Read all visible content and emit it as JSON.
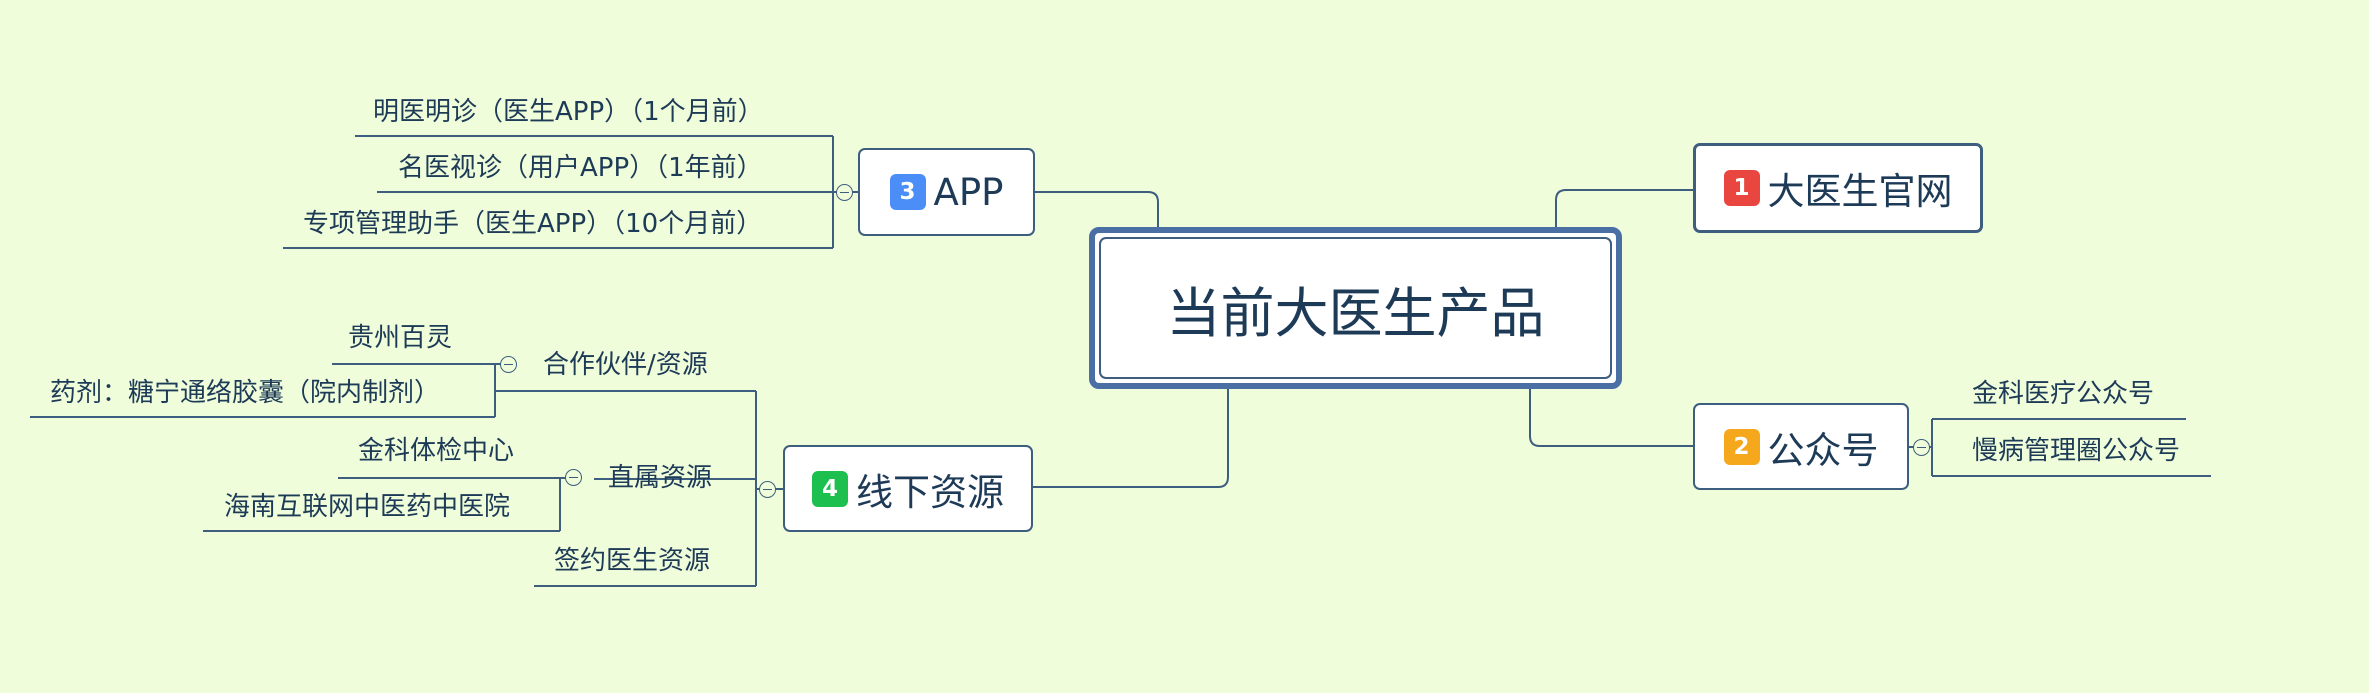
{
  "center": {
    "label": "当前大医生产品"
  },
  "colors": {
    "background": "#f0fddb",
    "line": "#3d5e7f",
    "center_border": "#4a6fa5",
    "badge_1": "#e8463e",
    "badge_2": "#f5a81c",
    "badge_3": "#4c8ef7",
    "badge_4": "#1dbf4f"
  },
  "topics": {
    "official_site": {
      "badge": "1",
      "label": "大医生官网"
    },
    "wechat": {
      "badge": "2",
      "label": "公众号",
      "children": [
        "金科医疗公众号",
        "慢病管理圈公众号"
      ]
    },
    "app": {
      "badge": "3",
      "label": "APP",
      "children": [
        "明医明诊（医生APP）（1个月前）",
        "名医视诊（用户APP）（1年前）",
        "专项管理助手（医生APP）（10个月前）"
      ]
    },
    "offline": {
      "badge": "4",
      "label": "线下资源",
      "partners": {
        "label": "合作伙伴/资源",
        "children": [
          "贵州百灵",
          "药剂：糖宁通络胶囊（院内制剂）"
        ]
      },
      "direct": {
        "label": "直属资源",
        "children": [
          "金科体检中心",
          "海南互联网中医药中医院"
        ]
      },
      "doctors": {
        "label": "签约医生资源"
      }
    }
  }
}
